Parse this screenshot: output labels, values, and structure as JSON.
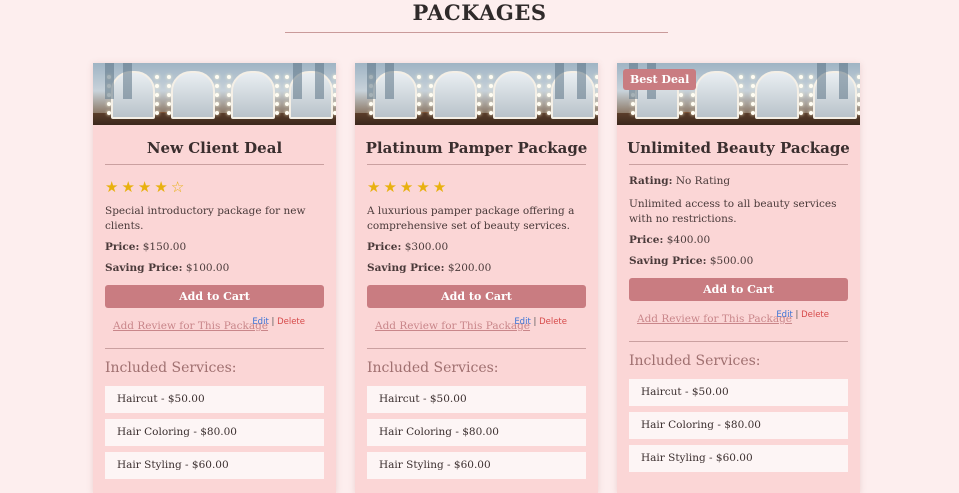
{
  "page": {
    "title": "PACKAGES"
  },
  "cards": [
    {
      "title": "New Client Deal",
      "rating_type": "stars",
      "stars": 4,
      "stars_max": 5,
      "description": "Special introductory package for new clients.",
      "price_label": "Price:",
      "price": "$150.00",
      "saving_label": "Saving Price:",
      "saving": "$100.00",
      "cart_label": "Add to Cart",
      "review_label": "Add Review for This Package",
      "edit_label": "Edit",
      "separator": "|",
      "delete_label": "Delete",
      "included_label": "Included Services:",
      "services": [
        "Haircut - $50.00",
        "Hair Coloring - $80.00",
        "Hair Styling - $60.00"
      ]
    },
    {
      "title": "Platinum Pamper Package",
      "rating_type": "stars",
      "stars": 5,
      "stars_max": 5,
      "description": "A luxurious pamper package offering a comprehensive set of beauty services.",
      "price_label": "Price:",
      "price": "$300.00",
      "saving_label": "Saving Price:",
      "saving": "$200.00",
      "cart_label": "Add to Cart",
      "review_label": "Add Review for This Package",
      "edit_label": "Edit",
      "separator": "|",
      "delete_label": "Delete",
      "included_label": "Included Services:",
      "services": [
        "Haircut - $50.00",
        "Hair Coloring - $80.00",
        "Hair Styling - $60.00"
      ]
    },
    {
      "badge": "Best Deal",
      "title": "Unlimited Beauty Package",
      "rating_type": "text",
      "rating_label": "Rating:",
      "rating_text": "No Rating",
      "description": "Unlimited access to all beauty services with no restrictions.",
      "price_label": "Price:",
      "price": "$400.00",
      "saving_label": "Saving Price:",
      "saving": "$500.00",
      "cart_label": "Add to Cart",
      "review_label": "Add Review for This Package",
      "edit_label": "Edit",
      "separator": "|",
      "delete_label": "Delete",
      "included_label": "Included Services:",
      "services": [
        "Haircut - $50.00",
        "Hair Coloring - $80.00",
        "Hair Styling - $60.00"
      ]
    }
  ],
  "colors": {
    "background": "#fdeeee",
    "card": "#fbd6d6",
    "accent": "#c97c81",
    "star": "#e8b10f",
    "edit": "#3b73d6",
    "delete": "#d64a4a"
  },
  "icons": {
    "star_full": "star-icon",
    "star_empty": "star-outline-icon"
  }
}
